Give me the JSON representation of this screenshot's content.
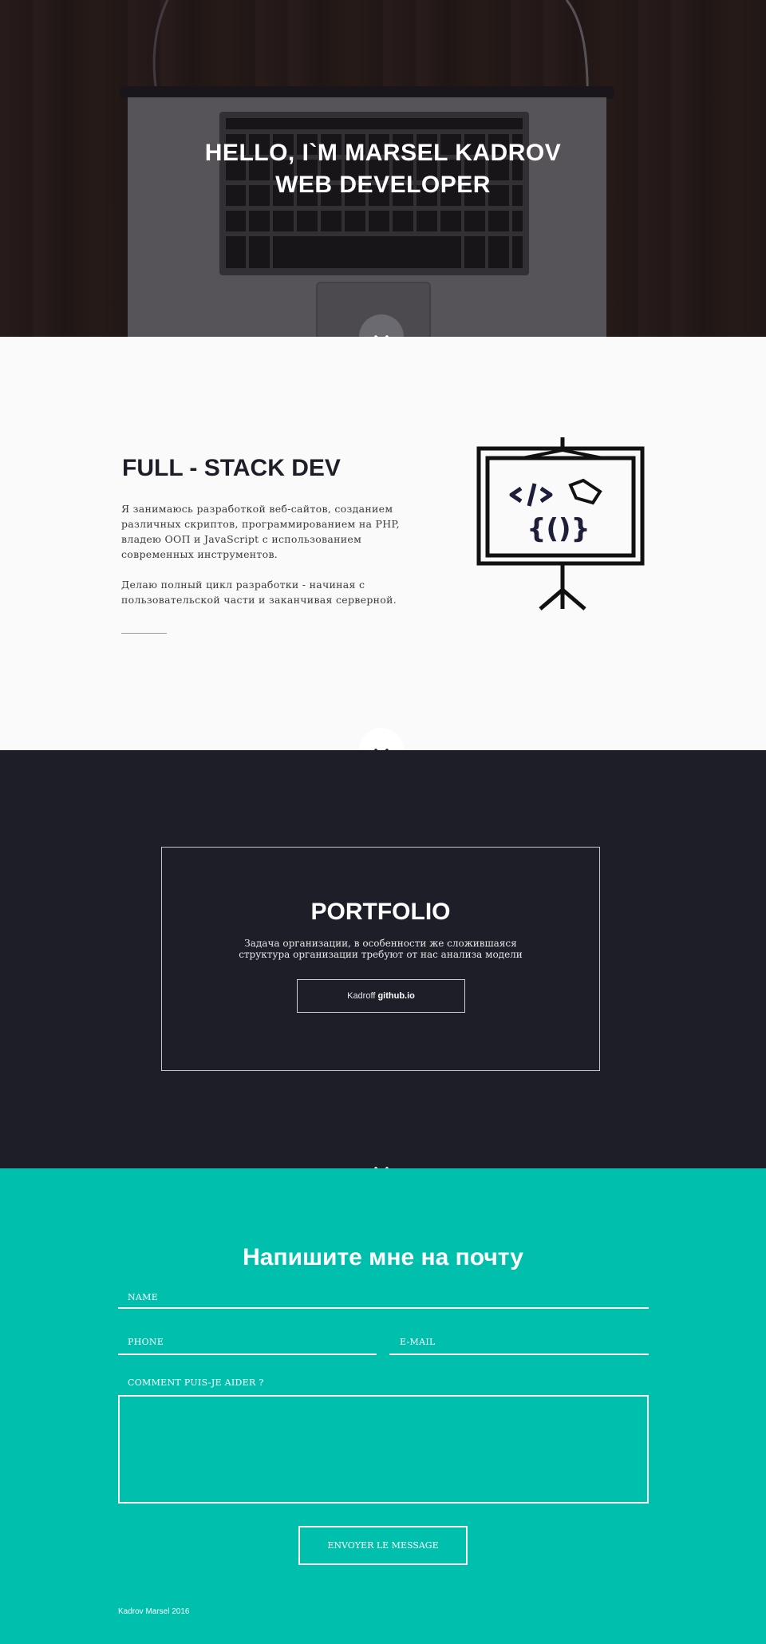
{
  "hero": {
    "line1": "HELLO, I`M MARSEL KADROV",
    "line2": "WEB DEVELOPER"
  },
  "about": {
    "title_regular": "FULL - STACK ",
    "title_bold": "DEV",
    "paragraph1": "Я занимаюсь разработкой веб-сайтов, созданием различных скриптов, программированием на PHP, владею ООП и JavaScript с использованием современных инструментов.",
    "paragraph2": "Делаю полный цикл разработки - начиная с пользовательской части и заканчивая серверной.",
    "illustration_icon": "presentation-board-code-icon"
  },
  "portfolio": {
    "title": "PORTFOLIO",
    "description_line1": "Задача организации, в особенности же сложившаяся",
    "description_line2": "структура организации требуют от нас анализа модели",
    "link_prefix": "Kadroff ",
    "link_bold": "github.io"
  },
  "contact": {
    "title": "Напишите мне на почту",
    "name_placeholder": "NAME",
    "phone_placeholder": "PHONE",
    "email_placeholder": "E-MAIL",
    "message_placeholder": "COMMENT PUIS-JE AIDER ?",
    "submit_label": "ENVOYER LE MESSAGE"
  },
  "footer": {
    "copyright": "Kadrov Marsel 2016"
  },
  "icons": {
    "scroll_down": "chevron-down-icon"
  },
  "colors": {
    "dark": "#1e1e28",
    "accent": "#00bfad",
    "light_bg": "#fafafa"
  }
}
